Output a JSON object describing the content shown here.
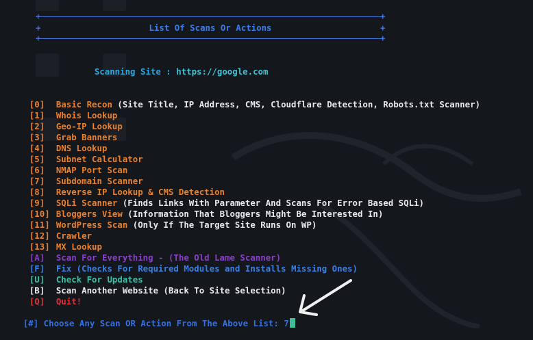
{
  "header": {
    "title": "List Of Scans Or Actions"
  },
  "site": {
    "label": "Scanning Site : ",
    "url": "https://google.com"
  },
  "menu": [
    {
      "key": "[0]",
      "label": "Basic Recon",
      "desc": " (Site Title, IP Address, CMS, Cloudflare Detection, Robots.txt Scanner)",
      "color": "#e8822f"
    },
    {
      "key": "[1]",
      "label": "Whois Lookup",
      "desc": "",
      "color": "#e8822f"
    },
    {
      "key": "[2]",
      "label": "Geo-IP Lookup",
      "desc": "",
      "color": "#e8822f"
    },
    {
      "key": "[3]",
      "label": "Grab Banners",
      "desc": "",
      "color": "#e8822f"
    },
    {
      "key": "[4]",
      "label": "DNS Lookup",
      "desc": "",
      "color": "#e8822f"
    },
    {
      "key": "[5]",
      "label": "Subnet Calculator",
      "desc": "",
      "color": "#e8822f"
    },
    {
      "key": "[6]",
      "label": "NMAP Port Scan",
      "desc": "",
      "color": "#e8822f"
    },
    {
      "key": "[7]",
      "label": "Subdomain Scanner",
      "desc": "",
      "color": "#e8822f"
    },
    {
      "key": "[8]",
      "label": "Reverse IP Lookup & CMS Detection",
      "desc": "",
      "color": "#e8822f"
    },
    {
      "key": "[9]",
      "label": "SQLi Scanner",
      "desc": " (Finds Links With Parameter And Scans For Error Based SQLi)",
      "color": "#e8822f"
    },
    {
      "key": "[10]",
      "label": "Bloggers View",
      "desc": " (Information That Bloggers Might Be Interested In)",
      "color": "#e8822f"
    },
    {
      "key": "[11]",
      "label": "WordPress Scan",
      "desc": " (Only If The Target Site Runs On WP)",
      "color": "#e8822f"
    },
    {
      "key": "[12]",
      "label": "Crawler",
      "desc": "",
      "color": "#e8822f"
    },
    {
      "key": "[13]",
      "label": "MX Lookup",
      "desc": "",
      "color": "#e8822f"
    },
    {
      "key": "[A]",
      "label": "Scan For Everything - (The Old Lame Scanner)",
      "desc": "",
      "color": "#8b3fc9"
    },
    {
      "key": "[F]",
      "label": "Fix (Checks For Required Modules and Installs Missing Ones)",
      "desc": "",
      "color": "#3a7fe6"
    },
    {
      "key": "[U]",
      "label": "Check For Updates",
      "desc": "",
      "color": "#38c2a6"
    },
    {
      "key": "[B]",
      "label": "Scan Another Website (Back To Site Selection)",
      "desc": "",
      "color": "#e9e9e9"
    },
    {
      "key": "[Q]",
      "label": "Quit!",
      "desc": "",
      "color": "#e0313a"
    }
  ],
  "prompt": {
    "text": "[#] Choose Any Scan OR Action From The Above List: ",
    "input": "7"
  },
  "colors": {
    "background": "#14171c",
    "rule": "#3f73e0",
    "cursor": "#3fbf9a",
    "arrow": "#f0f0f0"
  }
}
